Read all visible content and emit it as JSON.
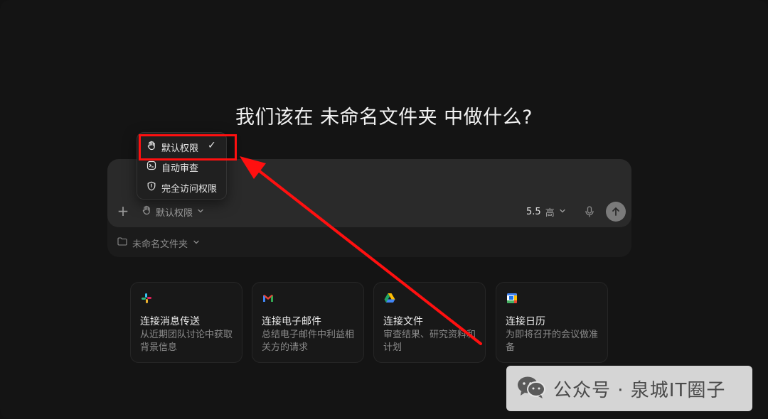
{
  "heading": "我们该在 未命名文件夹 中做什么?",
  "permission_menu": {
    "items": [
      {
        "label": "默认权限",
        "icon": "hand-icon",
        "selected": true
      },
      {
        "label": "自动审查",
        "icon": "terminal-icon",
        "selected": false
      },
      {
        "label": "完全访问权限",
        "icon": "alert-circle-icon",
        "selected": false
      }
    ],
    "checkmark": "✓"
  },
  "composer": {
    "plus": "+",
    "permission_label": "默认权限",
    "model_version": "5.5",
    "model_level": "高",
    "folder_label": "未命名文件夹"
  },
  "cards": [
    {
      "title": "连接消息传送",
      "desc": "从近期团队讨论中获取背景信息",
      "icon": "slack-icon"
    },
    {
      "title": "连接电子邮件",
      "desc": "总结电子邮件中利益相关方的请求",
      "icon": "gmail-icon"
    },
    {
      "title": "连接文件",
      "desc": "审查结果、研究资料和计划",
      "icon": "google-drive-icon"
    },
    {
      "title": "连接日历",
      "desc": "为即将召开的会议做准备",
      "icon": "google-calendar-icon"
    }
  ],
  "watermark": "公众号 · 泉城IT圈子",
  "colors": {
    "highlight": "#ff1010",
    "background": "#141414",
    "composer": "#2a2a2a"
  }
}
